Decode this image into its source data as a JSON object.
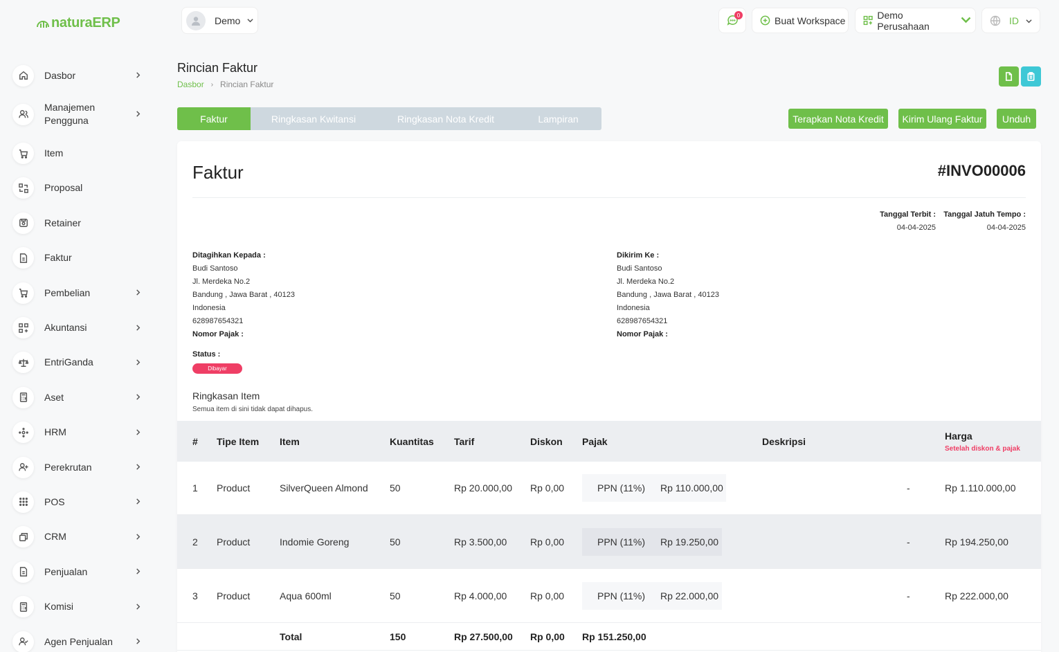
{
  "brand": {
    "name_part1": "natura",
    "name_part2": "ERP",
    "accent": "#6fbf4a"
  },
  "sidebar": {
    "items": [
      {
        "label": "Dasbor",
        "icon": "home-icon",
        "chevron": true
      },
      {
        "label": "Manajemen Pengguna",
        "icon": "users-icon",
        "chevron": true
      },
      {
        "label": "Item",
        "icon": "cart-icon",
        "chevron": false
      },
      {
        "label": "Proposal",
        "icon": "swap-icon",
        "chevron": false
      },
      {
        "label": "Retainer",
        "icon": "retainer-icon",
        "chevron": false
      },
      {
        "label": "Faktur",
        "icon": "document-icon",
        "chevron": false
      },
      {
        "label": "Pembelian",
        "icon": "cart-icon",
        "chevron": true
      },
      {
        "label": "Akuntansi",
        "icon": "grid-plus-icon",
        "chevron": true
      },
      {
        "label": "EntriGanda",
        "icon": "scale-icon",
        "chevron": true
      },
      {
        "label": "Aset",
        "icon": "calculator-icon",
        "chevron": true
      },
      {
        "label": "HRM",
        "icon": "hrm-icon",
        "chevron": true
      },
      {
        "label": "Perekrutan",
        "icon": "user-plus-icon",
        "chevron": true
      },
      {
        "label": "POS",
        "icon": "dots-grid-icon",
        "chevron": true
      },
      {
        "label": "CRM",
        "icon": "layers-icon",
        "chevron": true
      },
      {
        "label": "Penjualan",
        "icon": "document-icon",
        "chevron": true
      },
      {
        "label": "Komisi",
        "icon": "calculator-icon",
        "chevron": true
      },
      {
        "label": "Agen Penjualan",
        "icon": "user-check-icon",
        "chevron": true
      }
    ]
  },
  "topbar": {
    "user": "Demo",
    "notifications": "0",
    "workspace_btn": "Buat Workspace",
    "company": "Demo Perusahaan",
    "language": "ID"
  },
  "page": {
    "title": "Rincian Faktur",
    "breadcrumb_home": "Dasbor",
    "breadcrumb_current": "Rincian Faktur"
  },
  "tabs": [
    "Faktur",
    "Ringkasan Kwitansi",
    "Ringkasan Nota Kredit",
    "Lampiran"
  ],
  "actions": {
    "apply_credit": "Terapkan Nota Kredit",
    "resend": "Kirim Ulang Faktur",
    "download": "Unduh"
  },
  "invoice": {
    "title": "Faktur",
    "number": "#INVO00006",
    "issue_label": "Tanggal Terbit :",
    "issue_date": "04-04-2025",
    "due_label": "Tanggal Jatuh Tempo :",
    "due_date": "04-04-2025",
    "bill_to": {
      "label": "Ditagihkan Kepada :",
      "name": "Budi Santoso",
      "street": "Jl. Merdeka No.2",
      "city": "Bandung , Jawa Barat , 40123",
      "country": "Indonesia",
      "phone": "628987654321",
      "tax_label": "Nomor Pajak :"
    },
    "ship_to": {
      "label": "Dikirim Ke :",
      "name": "Budi Santoso",
      "street": "Jl. Merdeka No.2",
      "city": "Bandung , Jawa Barat , 40123",
      "country": "Indonesia",
      "phone": "628987654321",
      "tax_label": "Nomor Pajak :"
    },
    "status_label": "Status :",
    "status": "Dibayar",
    "status_color": "#ef3e65",
    "summary_title": "Ringkasan Item",
    "summary_sub": "Semua item di sini tidak dapat dihapus."
  },
  "table": {
    "headers": {
      "no": "#",
      "type": "Tipe Item",
      "item": "Item",
      "qty": "Kuantitas",
      "rate": "Tarif",
      "discount": "Diskon",
      "tax": "Pajak",
      "desc": "Deskripsi",
      "price": "Harga",
      "price_sub": "Setelah diskon & pajak"
    },
    "rows": [
      {
        "no": "1",
        "type": "Product",
        "item": "SilverQueen Almond",
        "qty": "50",
        "rate": "Rp 20.000,00",
        "discount": "Rp 0,00",
        "tax_name": "PPN (11%)",
        "tax_amount": "Rp 110.000,00",
        "desc": "-",
        "price": "Rp 1.110.000,00"
      },
      {
        "no": "2",
        "type": "Product",
        "item": "Indomie Goreng",
        "qty": "50",
        "rate": "Rp 3.500,00",
        "discount": "Rp 0,00",
        "tax_name": "PPN (11%)",
        "tax_amount": "Rp 19.250,00",
        "desc": "-",
        "price": "Rp 194.250,00"
      },
      {
        "no": "3",
        "type": "Product",
        "item": "Aqua 600ml",
        "qty": "50",
        "rate": "Rp 4.000,00",
        "discount": "Rp 0,00",
        "tax_name": "PPN (11%)",
        "tax_amount": "Rp 22.000,00",
        "desc": "-",
        "price": "Rp 222.000,00"
      }
    ],
    "total": {
      "label": "Total",
      "qty": "150",
      "rate": "Rp 27.500,00",
      "discount": "Rp 0,00",
      "tax": "Rp 151.250,00"
    }
  }
}
